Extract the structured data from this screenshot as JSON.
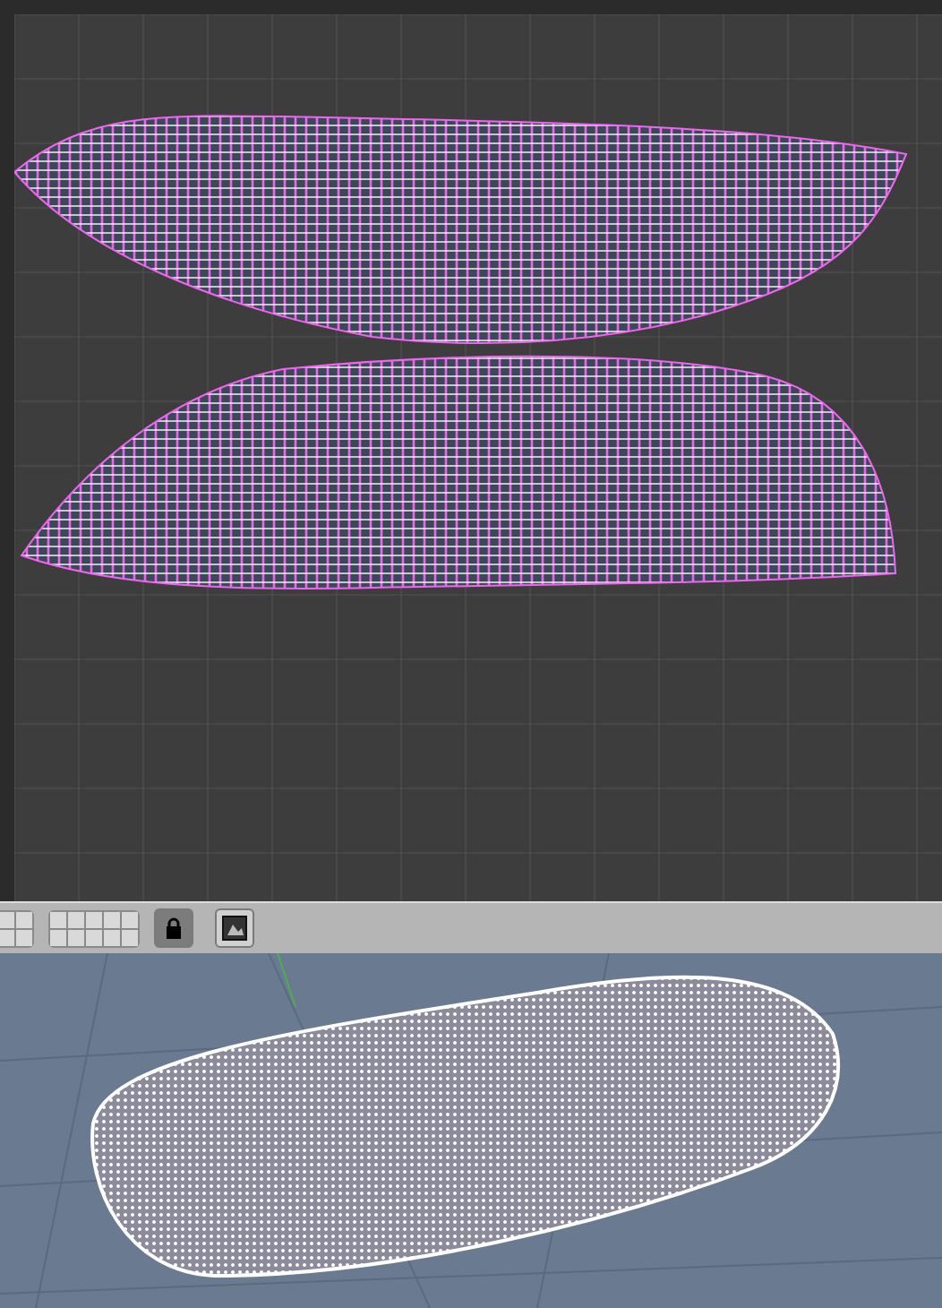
{
  "uv_editor": {
    "mesh_selected": true
  },
  "toolbar": {
    "layer_groups": [
      {
        "layers": [
          {
            "selected": false
          },
          {
            "selected": false
          },
          {
            "selected": false
          },
          {
            "selected": false
          }
        ]
      },
      {
        "layers": [
          {
            "selected": false
          },
          {
            "selected": false
          },
          {
            "selected": false
          },
          {
            "selected": false
          },
          {
            "selected": false
          },
          {
            "selected": false
          },
          {
            "selected": false
          },
          {
            "selected": false
          },
          {
            "selected": false
          },
          {
            "selected": false
          }
        ]
      }
    ],
    "lock": {
      "on": true
    }
  },
  "viewport": {
    "mesh_selected": true
  }
}
